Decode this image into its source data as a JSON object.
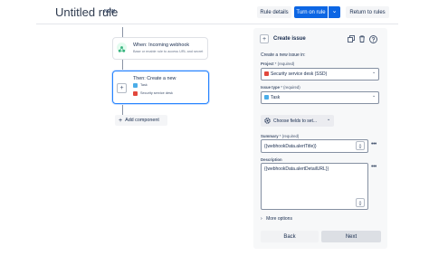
{
  "header": {
    "title": "Untitled rule",
    "badge": "NEW",
    "rule_details": "Rule details",
    "turn_on": "Turn on rule",
    "turn_on_chevron": "⌄",
    "return": "Return to rules"
  },
  "flow": {
    "trigger_title": "When: Incoming webhook",
    "trigger_sub": "Base or enable rule to access URL and secret",
    "action_plus": "+",
    "action_title": "Then: Create a new",
    "action_type": "Task",
    "action_project": "Security service desk",
    "add_component_icon": "+",
    "add_component": "Add component"
  },
  "panel": {
    "plus": "+",
    "title": "Create issue",
    "subtitle": "Create a new issue in:",
    "project_label": "Project",
    "project_req": "* (required)",
    "project_value": "Security service desk (SSD)",
    "issue_type_label": "Issue type",
    "issue_type_req": "* (required)",
    "issue_type_value": "Task",
    "chevron": "⌄",
    "choose_fields": "Choose fields to set...",
    "summary_label": "Summary",
    "summary_req": "* (required)",
    "summary_value": "{{webhookData.alertTitle}}",
    "description_label": "Description",
    "description_value": "{{webhookData.alertDetailURL}}",
    "smart_value_icon": "{}",
    "more": "•••",
    "more_options_chevron": "›",
    "more_options": "More options",
    "back": "Back",
    "next": "Next"
  },
  "colors": {
    "primary": "#0c66e4",
    "task": "#4bade8",
    "project": "#e2483d",
    "selected_border": "#2684ff",
    "trigger_icon": "#36b37e"
  }
}
